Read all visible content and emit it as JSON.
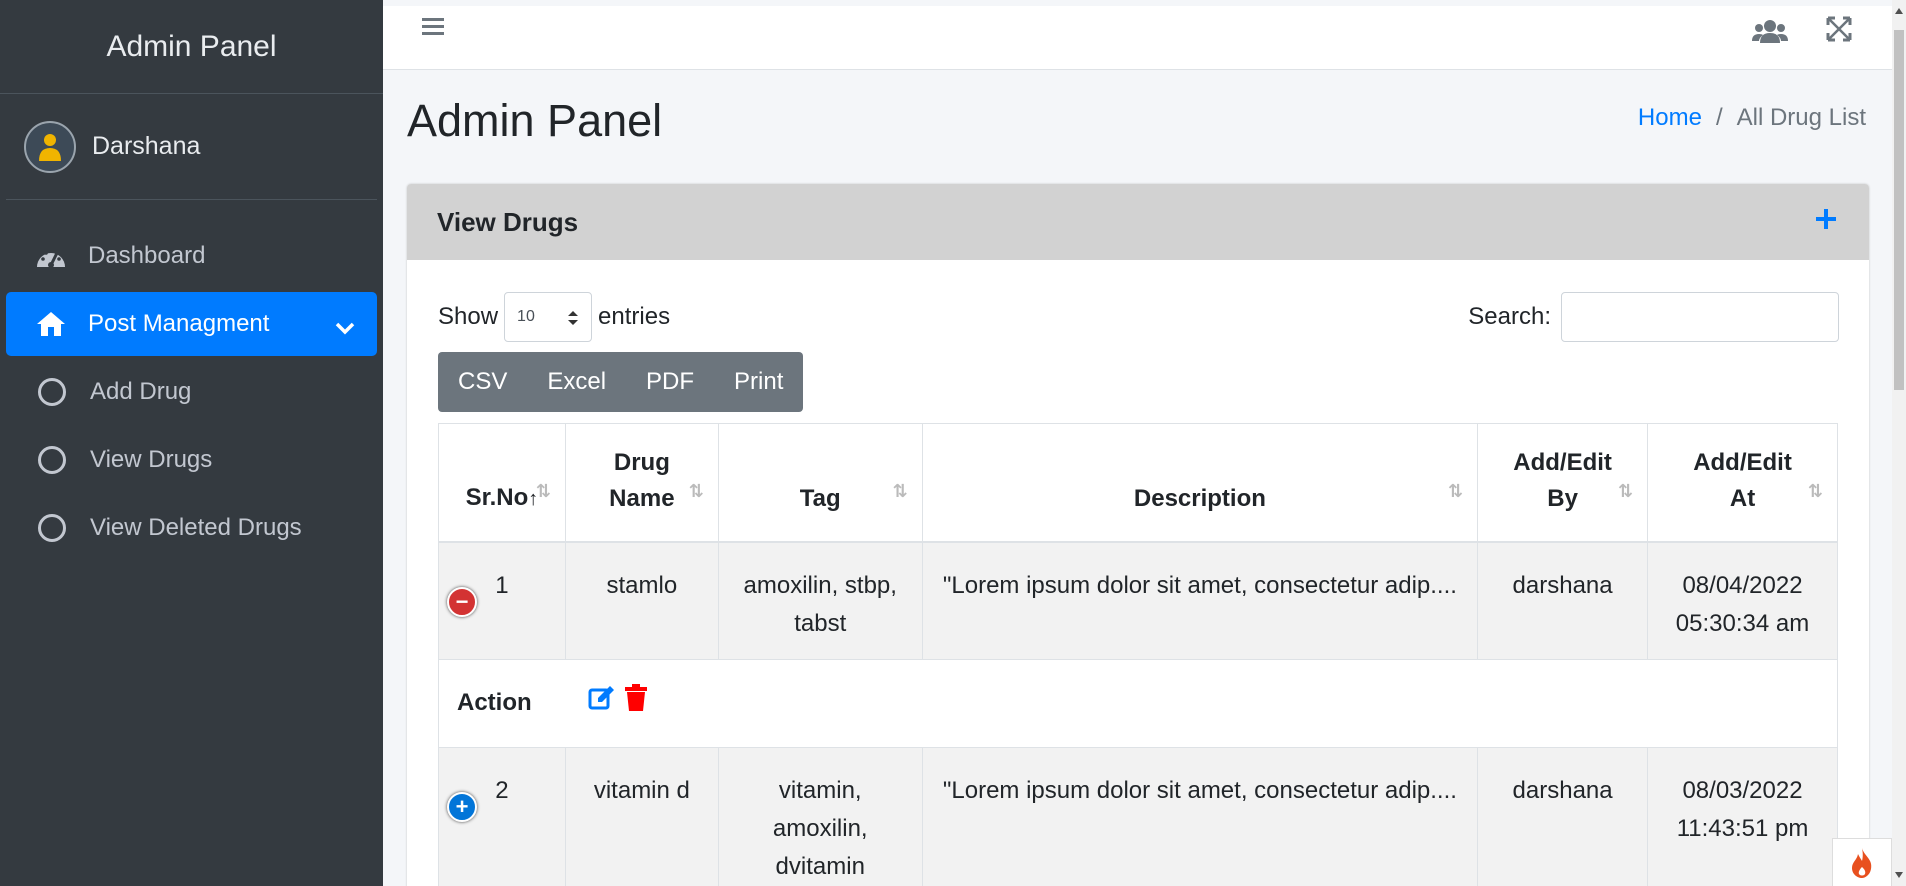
{
  "sidebar": {
    "brand": "Admin Panel",
    "user": "Darshana",
    "items": [
      {
        "label": "Dashboard",
        "icon": "tachometer-icon"
      },
      {
        "label": "Post Managment",
        "icon": "home-icon"
      },
      {
        "label": "Add Drug",
        "icon": "circle-icon"
      },
      {
        "label": "View Drugs",
        "icon": "circle-icon"
      },
      {
        "label": "View Deleted Drugs",
        "icon": "circle-icon"
      }
    ]
  },
  "header": {
    "title": "Admin Panel",
    "breadcrumb": {
      "home": "Home",
      "sep": "/",
      "current": "All Drug List"
    }
  },
  "card": {
    "title": "View Drugs",
    "show_label": "Show",
    "entries_value": "10",
    "entries_label": "entries",
    "search_label": "Search:",
    "buttons": [
      "CSV",
      "Excel",
      "PDF",
      "Print"
    ]
  },
  "table": {
    "headers": [
      {
        "line1": "",
        "line2": "Sr.No"
      },
      {
        "line1": "Drug",
        "line2": "Name"
      },
      {
        "line1": "",
        "line2": "Tag"
      },
      {
        "line1": "",
        "line2": "Description"
      },
      {
        "line1": "Add/Edit",
        "line2": "By"
      },
      {
        "line1": "Add/Edit",
        "line2": "At"
      }
    ],
    "rows": [
      {
        "sr": "1",
        "name": "stamlo",
        "tag1": "amoxilin, stbp,",
        "tag2": "tabst",
        "tag3": "",
        "desc": "\"Lorem ipsum dolor sit amet, consectetur adip....",
        "by": "darshana",
        "date": "08/04/2022",
        "time": "05:30:34 am"
      },
      {
        "sr": "2",
        "name": "vitamin d",
        "tag1": "vitamin,",
        "tag2": "amoxilin,",
        "tag3": "dvitamin",
        "desc": "\"Lorem ipsum dolor sit amet, consectetur adip....",
        "by": "darshana",
        "date": "08/03/2022",
        "time": "11:43:51 pm"
      }
    ],
    "action_label": "Action"
  },
  "colors": {
    "primary": "#007bff",
    "sidebar": "#343a40",
    "danger": "#ff0000"
  }
}
